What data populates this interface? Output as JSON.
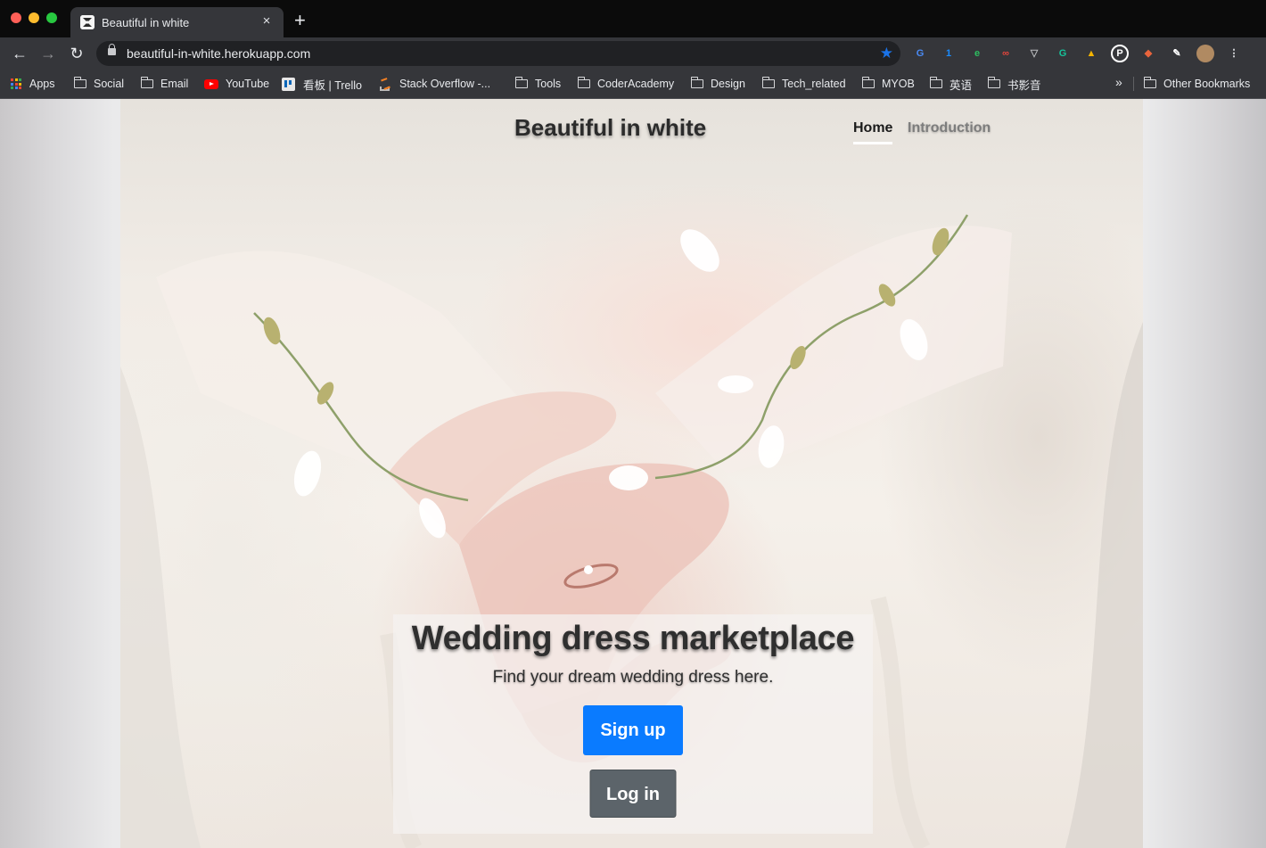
{
  "browser": {
    "tab": {
      "title": "Beautiful in white",
      "close_icon": "×"
    },
    "new_tab_icon": "+",
    "nav": {
      "back_icon": "←",
      "forward_icon": "→",
      "reload_icon": "↻"
    },
    "address_bar": {
      "url": "beautiful-in-white.herokuapp.com",
      "bookmark_star_icon": "★"
    },
    "extensions": [
      {
        "name": "google-translate-icon",
        "glyph": "G",
        "color": "#4a8af4"
      },
      {
        "name": "onepassword-icon",
        "glyph": "1",
        "color": "#1a8cff"
      },
      {
        "name": "evernote-icon",
        "glyph": "e",
        "color": "#2dbe60"
      },
      {
        "name": "infinity-icon",
        "glyph": "∞",
        "color": "#e8453c"
      },
      {
        "name": "pocket-icon",
        "glyph": "▽",
        "color": "#b9babd"
      },
      {
        "name": "grammarly-icon",
        "glyph": "G",
        "color": "#15c39a"
      },
      {
        "name": "google-drive-icon",
        "glyph": "▲",
        "color": "#f4b400"
      },
      {
        "name": "pinterest-icon",
        "glyph": "P",
        "color": "#ffffff"
      },
      {
        "name": "ublock-icon",
        "glyph": "◆",
        "color": "#e8643c"
      },
      {
        "name": "pen-extension-icon",
        "glyph": "✎",
        "color": "#ffffff"
      },
      {
        "name": "profile-avatar",
        "glyph": "",
        "color": "#b08a62"
      },
      {
        "name": "menu-kebab-icon",
        "glyph": "⋮",
        "color": "#e8eaed"
      }
    ],
    "bookmarks": [
      {
        "label": "Apps",
        "icon": "apps-grid-icon"
      },
      {
        "label": "Social",
        "icon": "folder-icon"
      },
      {
        "label": "Email",
        "icon": "folder-icon"
      },
      {
        "label": "YouTube",
        "icon": "youtube-icon"
      },
      {
        "label": "看板 | Trello",
        "icon": "trello-icon"
      },
      {
        "label": "Stack Overflow -...",
        "icon": "stackoverflow-icon"
      },
      {
        "label": "Tools",
        "icon": "folder-icon"
      },
      {
        "label": "CoderAcademy",
        "icon": "folder-icon"
      },
      {
        "label": "Design",
        "icon": "folder-icon"
      },
      {
        "label": "Tech_related",
        "icon": "folder-icon"
      },
      {
        "label": "MYOB",
        "icon": "folder-icon"
      },
      {
        "label": "英语",
        "icon": "folder-icon"
      },
      {
        "label": "书影音",
        "icon": "folder-icon"
      }
    ],
    "more_bookmarks_icon": "»",
    "other_bookmarks": "Other Bookmarks"
  },
  "site": {
    "brand": "Beautiful in white",
    "nav": [
      {
        "label": "Home",
        "active": true
      },
      {
        "label": "Introduction",
        "active": false
      }
    ],
    "hero": {
      "title": "Wedding dress marketplace",
      "subtitle": "Find your dream wedding dress here.",
      "signup_label": "Sign up",
      "login_label": "Log in"
    }
  },
  "colors": {
    "primary_button": "#0a7bff",
    "secondary_button": "#5c646a",
    "chrome_dark": "#202124"
  }
}
